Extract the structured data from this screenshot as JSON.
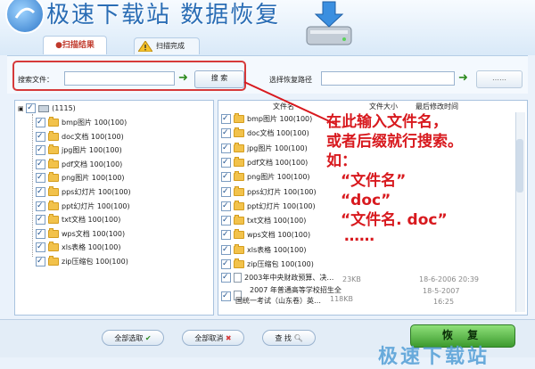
{
  "header": {
    "title": "极速下载站 数据恢复"
  },
  "tabs": [
    {
      "label": "●扫描结果"
    },
    {
      "label": "扫描完成"
    }
  ],
  "search": {
    "label": "搜索文件：",
    "value": "",
    "button": "搜 索"
  },
  "restore_path": {
    "label": "选择恢复路径",
    "value": "",
    "browse": "……"
  },
  "tree": {
    "root": "(1115)",
    "items": [
      "bmp图片 100(100)",
      "doc文档 100(100)",
      "jpg图片 100(100)",
      "pdf文档 100(100)",
      "png图片 100(100)",
      "pps幻灯片 100(100)",
      "ppt幻灯片 100(100)",
      "txt文档 100(100)",
      "wps文档 100(100)",
      "xls表格 100(100)",
      "zip压缩包 100(100)"
    ]
  },
  "list": {
    "headers": {
      "name": "文件名",
      "size": "文件大小",
      "time": "最后修改时间"
    },
    "folders": [
      "bmp图片 100(100)",
      "doc文档 100(100)",
      "jpg图片 100(100)",
      "pdf文档 100(100)",
      "png图片 100(100)",
      "pps幻灯片 100(100)",
      "ppt幻灯片 100(100)",
      "txt文档 100(100)",
      "wps文档 100(100)",
      "xls表格 100(100)",
      "zip压缩包 100(100)"
    ],
    "files": [
      {
        "name": "2003年中央财政预算、决…",
        "size": "23KB",
        "time": "18-6-2006 20:39"
      },
      {
        "name1": "2007 年普通高等学校招生全",
        "name2": "国统一考试（山东卷）英…",
        "size": "118KB",
        "time1": "18-5-2007",
        "time2": "16:25"
      }
    ]
  },
  "annotation": {
    "lines": [
      "在此输入文件名，",
      "或者后缀就行搜索。",
      "如：",
      "“文件名”",
      "“doc”",
      "“文件名. doc”",
      "……"
    ]
  },
  "buttons": {
    "select_all": "全部选取",
    "deselect_all": "全部取消",
    "find": "查 找",
    "restore": "恢 复"
  },
  "watermark": "极速下载站",
  "colors": {
    "accent_red": "#d8191e",
    "restore_green": "#3c9a2e",
    "brand_blue": "#2a6db5"
  }
}
